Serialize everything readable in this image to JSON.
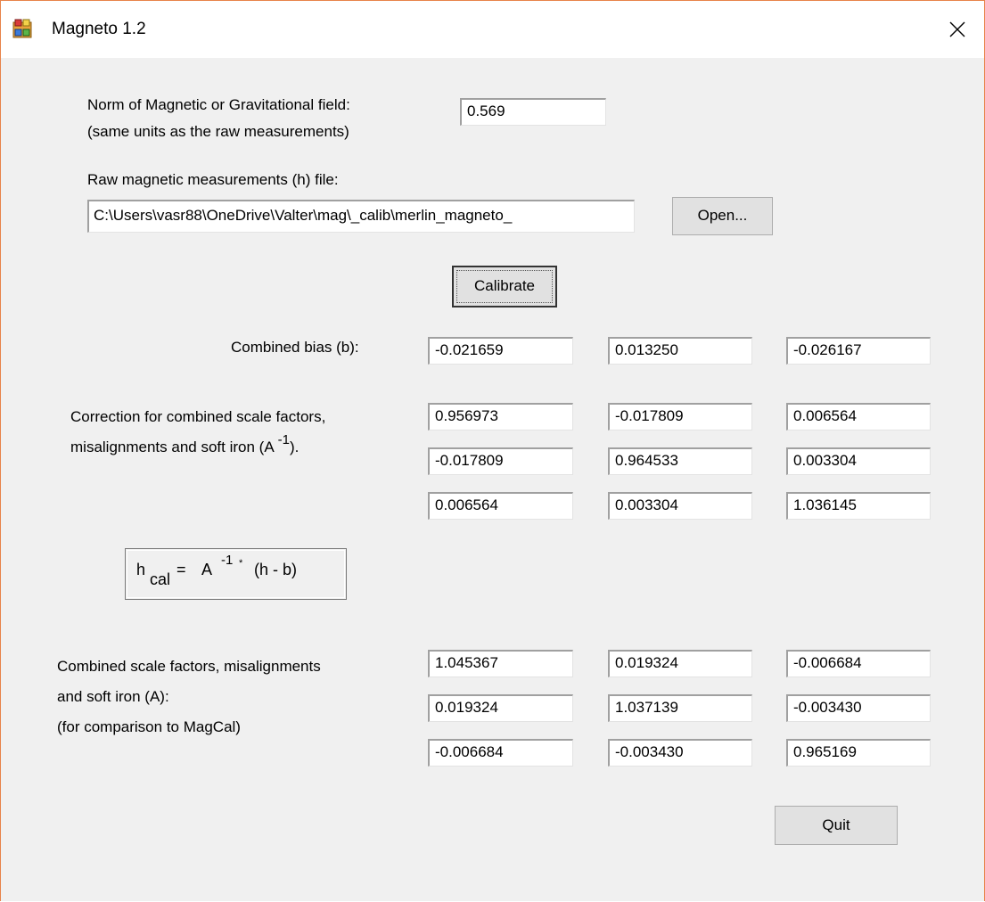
{
  "window": {
    "title": "Magneto 1.2",
    "close_glyph": "✕",
    "icon": "app-icon",
    "frame_color": "#e8834a"
  },
  "norm": {
    "label_line1": "Norm of Magnetic or Gravitational field:",
    "label_line2": "(same units as the raw measurements)",
    "value": "0.569"
  },
  "raw_file": {
    "label": "Raw magnetic measurements (h) file:",
    "path": "C:\\Users\\vasr88\\OneDrive\\Valter\\mag\\_calib\\merlin_magneto_",
    "open_label": "Open..."
  },
  "calibrate_label": "Calibrate",
  "bias": {
    "label": "Combined bias (b):",
    "values": [
      "-0.021659",
      "0.013250",
      "-0.026167"
    ]
  },
  "correction": {
    "label_line1": "Correction for combined scale factors,",
    "label_line2_prefix": "misalignments and soft iron (A",
    "label_sup": "-1",
    "label_suffix": ").",
    "rows": [
      [
        "0.956973",
        "-0.017809",
        "0.006564"
      ],
      [
        "-0.017809",
        "0.964533",
        "0.003304"
      ],
      [
        "0.006564",
        "0.003304",
        "1.036145"
      ]
    ]
  },
  "formula": {
    "h": "h",
    "cal": "cal",
    "eq": "=",
    "A": "A",
    "sup": "-1",
    "dot": "*",
    "rest": "(h - b)"
  },
  "scale": {
    "label_line1": "Combined scale factors, misalignments",
    "label_line2": "and soft iron (A):",
    "label_line3": "(for comparison to MagCal)",
    "rows": [
      [
        "1.045367",
        "0.019324",
        "-0.006684"
      ],
      [
        "0.019324",
        "1.037139",
        "-0.003430"
      ],
      [
        "-0.006684",
        "-0.003430",
        "0.965169"
      ]
    ]
  },
  "quit_label": "Quit"
}
